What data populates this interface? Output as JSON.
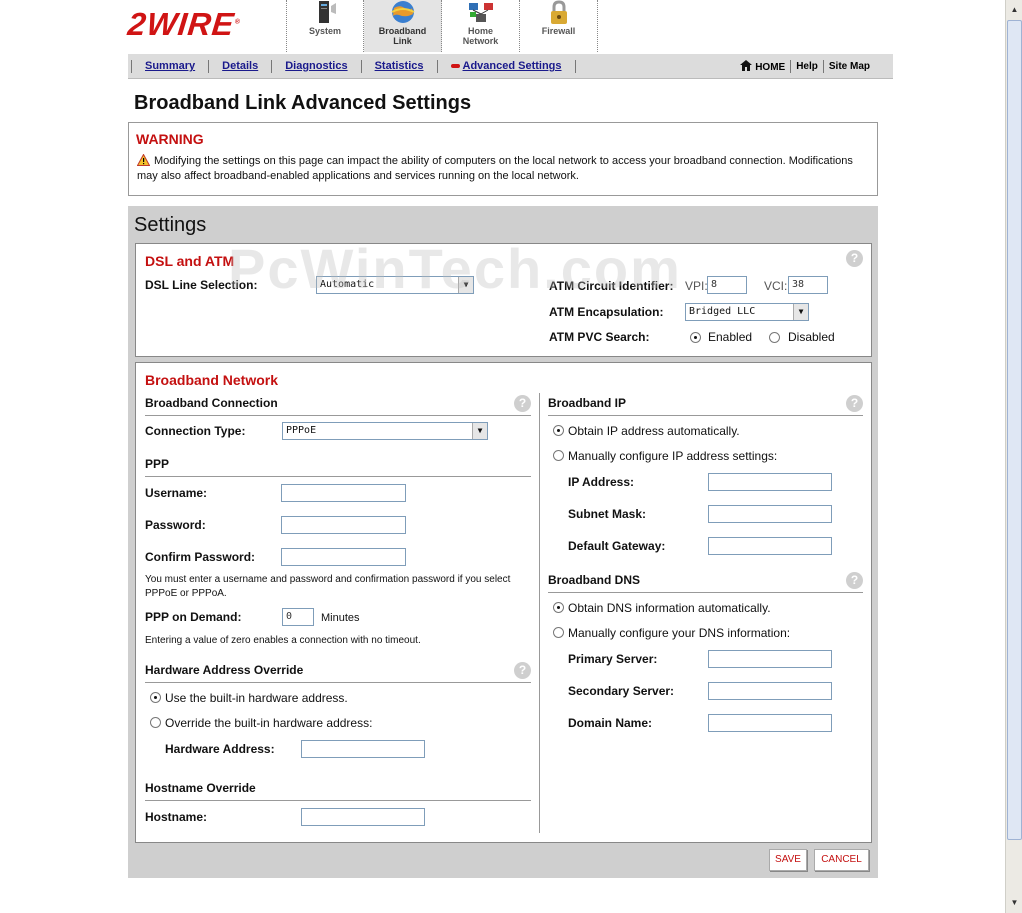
{
  "header": {
    "logo": "2WIRE",
    "tabs": [
      {
        "label_lines": [
          "System"
        ],
        "icon": "system-icon"
      },
      {
        "label_lines": [
          "Broadband",
          "Link"
        ],
        "icon": "globe-icon"
      },
      {
        "label_lines": [
          "Home",
          "Network"
        ],
        "icon": "network-icon"
      },
      {
        "label_lines": [
          "Firewall"
        ],
        "icon": "lock-icon"
      }
    ]
  },
  "subnav": {
    "links": [
      "Summary",
      "Details",
      "Diagnostics",
      "Statistics",
      "Advanced Settings"
    ],
    "home": "HOME",
    "help": "Help",
    "sitemap": "Site Map"
  },
  "page_title": "Broadband Link Advanced Settings",
  "warning": {
    "title": "WARNING",
    "text": "Modifying the settings on this page can impact the ability of computers on the local network to access your broadband connection. Modifications may also affect broadband-enabled applications and services running on the local network."
  },
  "settings": {
    "title": "Settings",
    "watermark": "PcWinTech.com",
    "dsl": {
      "title": "DSL and ATM",
      "line_selection_label": "DSL Line Selection:",
      "line_selection_value": "Automatic",
      "atm_circuit_label": "ATM Circuit Identifier:",
      "vpi_label": "VPI:",
      "vpi_value": "8",
      "vci_label": "VCI:",
      "vci_value": "38",
      "encapsulation_label": "ATM Encapsulation:",
      "encapsulation_value": "Bridged LLC",
      "pvc_search_label": "ATM PVC Search:",
      "pvc_enabled": "Enabled",
      "pvc_disabled": "Disabled"
    },
    "broadband": {
      "title": "Broadband Network",
      "connection_heading": "Broadband Connection",
      "connection_type_label": "Connection Type:",
      "connection_type_value": "PPPoE",
      "ppp_heading": "PPP",
      "username_label": "Username:",
      "password_label": "Password:",
      "confirm_label": "Confirm Password:",
      "ppp_note": "You must enter a username and password and confirmation password if you select PPPoE or PPPoA.",
      "ppp_demand_label": "PPP on Demand:",
      "ppp_demand_value": "0",
      "minutes": "Minutes",
      "demand_note": "Entering a value of zero enables a connection with no timeout.",
      "hw_heading": "Hardware Address Override",
      "hw_builtin": "Use the built-in hardware address.",
      "hw_override": "Override the built-in hardware address:",
      "hw_address_label": "Hardware Address:",
      "hostname_heading": "Hostname Override",
      "hostname_label": "Hostname:",
      "ip_heading": "Broadband IP",
      "ip_auto": "Obtain IP address automatically.",
      "ip_manual": "Manually configure IP address settings:",
      "ip_address_label": "IP Address:",
      "subnet_label": "Subnet Mask:",
      "gateway_label": "Default Gateway:",
      "dns_heading": "Broadband DNS",
      "dns_auto": "Obtain DNS information automatically.",
      "dns_manual": "Manually configure your DNS information:",
      "primary_label": "Primary Server:",
      "secondary_label": "Secondary Server:",
      "domain_label": "Domain Name:"
    },
    "save": "SAVE",
    "cancel": "CANCEL"
  },
  "colors": {
    "brand_red": "#d01414",
    "panel_gray": "#cfcfcf",
    "link_blue": "#1a1a8c"
  }
}
